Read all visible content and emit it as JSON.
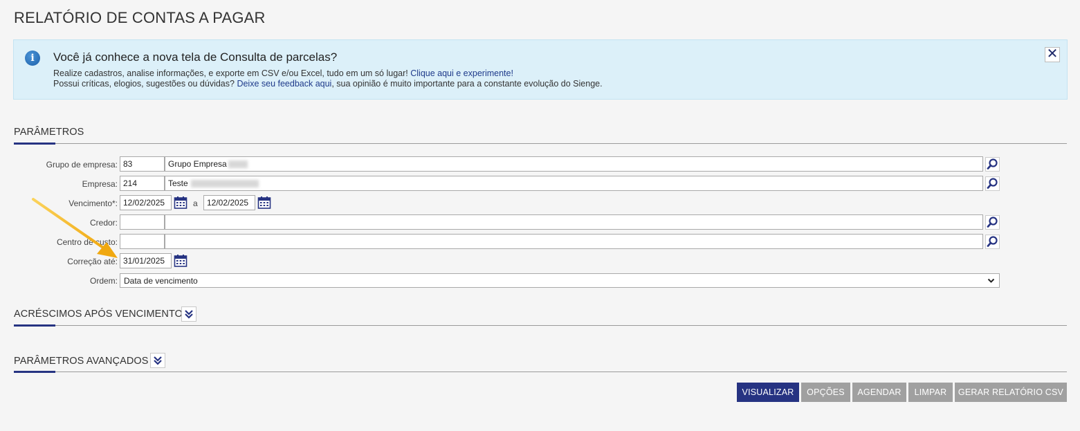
{
  "page": {
    "title": "RELATÓRIO DE CONTAS A PAGAR"
  },
  "banner": {
    "title": "Você já conhece a nova tela de Consulta de parcelas?",
    "line1_text": "Realize cadastros, analise informações, e exporte em CSV e/ou Excel, tudo em um só lugar! ",
    "line1_link": "Clique aqui e experimente!",
    "line2_text_before": "Possui críticas, elogios, sugestões ou dúvidas? ",
    "line2_link": "Deixe seu feedback aqui",
    "line2_text_after": ", sua opinião é muito importante para a constante evolução do Sienge.",
    "info_icon_glyph": "i",
    "close_glyph": "✕"
  },
  "parameters": {
    "section_title": "PARÂMETROS",
    "grupo_empresa": {
      "label": "Grupo de empresa:",
      "code": "83",
      "name": "Grupo Empresa"
    },
    "empresa": {
      "label": "Empresa:",
      "code": "214",
      "name": "Teste"
    },
    "vencimento": {
      "label": "Vencimento*:",
      "from": "12/02/2025",
      "separator": "a",
      "to": "12/02/2025"
    },
    "credor": {
      "label": "Credor:",
      "code": "",
      "name": ""
    },
    "centro_custo": {
      "label": "Centro de custo:",
      "code": "",
      "name": ""
    },
    "correcao": {
      "label": "Correção até:",
      "date": "31/01/2025"
    },
    "ordem": {
      "label": "Ordem:",
      "selected": "Data de vencimento"
    }
  },
  "sections": {
    "acrescimos": "ACRÉSCIMOS APÓS VENCIMENTO",
    "avancados": "PARÂMETROS AVANÇADOS"
  },
  "buttons": {
    "visualizar": "VISUALIZAR",
    "opcoes": "OPÇÕES",
    "agendar": "AGENDAR",
    "limpar": "LIMPAR",
    "gerar_csv": "GERAR RELATÓRIO CSV"
  },
  "icons": {
    "search": "search-icon",
    "calendar": "calendar-icon",
    "expand": "double-chevron-down-icon",
    "info": "info-icon",
    "close": "close-icon",
    "annotation": "arrow-annotation"
  },
  "colors": {
    "primary": "#263382",
    "secondary_button": "#a0a0a0",
    "banner_bg": "#dcf0f9",
    "arrow": "#f5b41a"
  }
}
